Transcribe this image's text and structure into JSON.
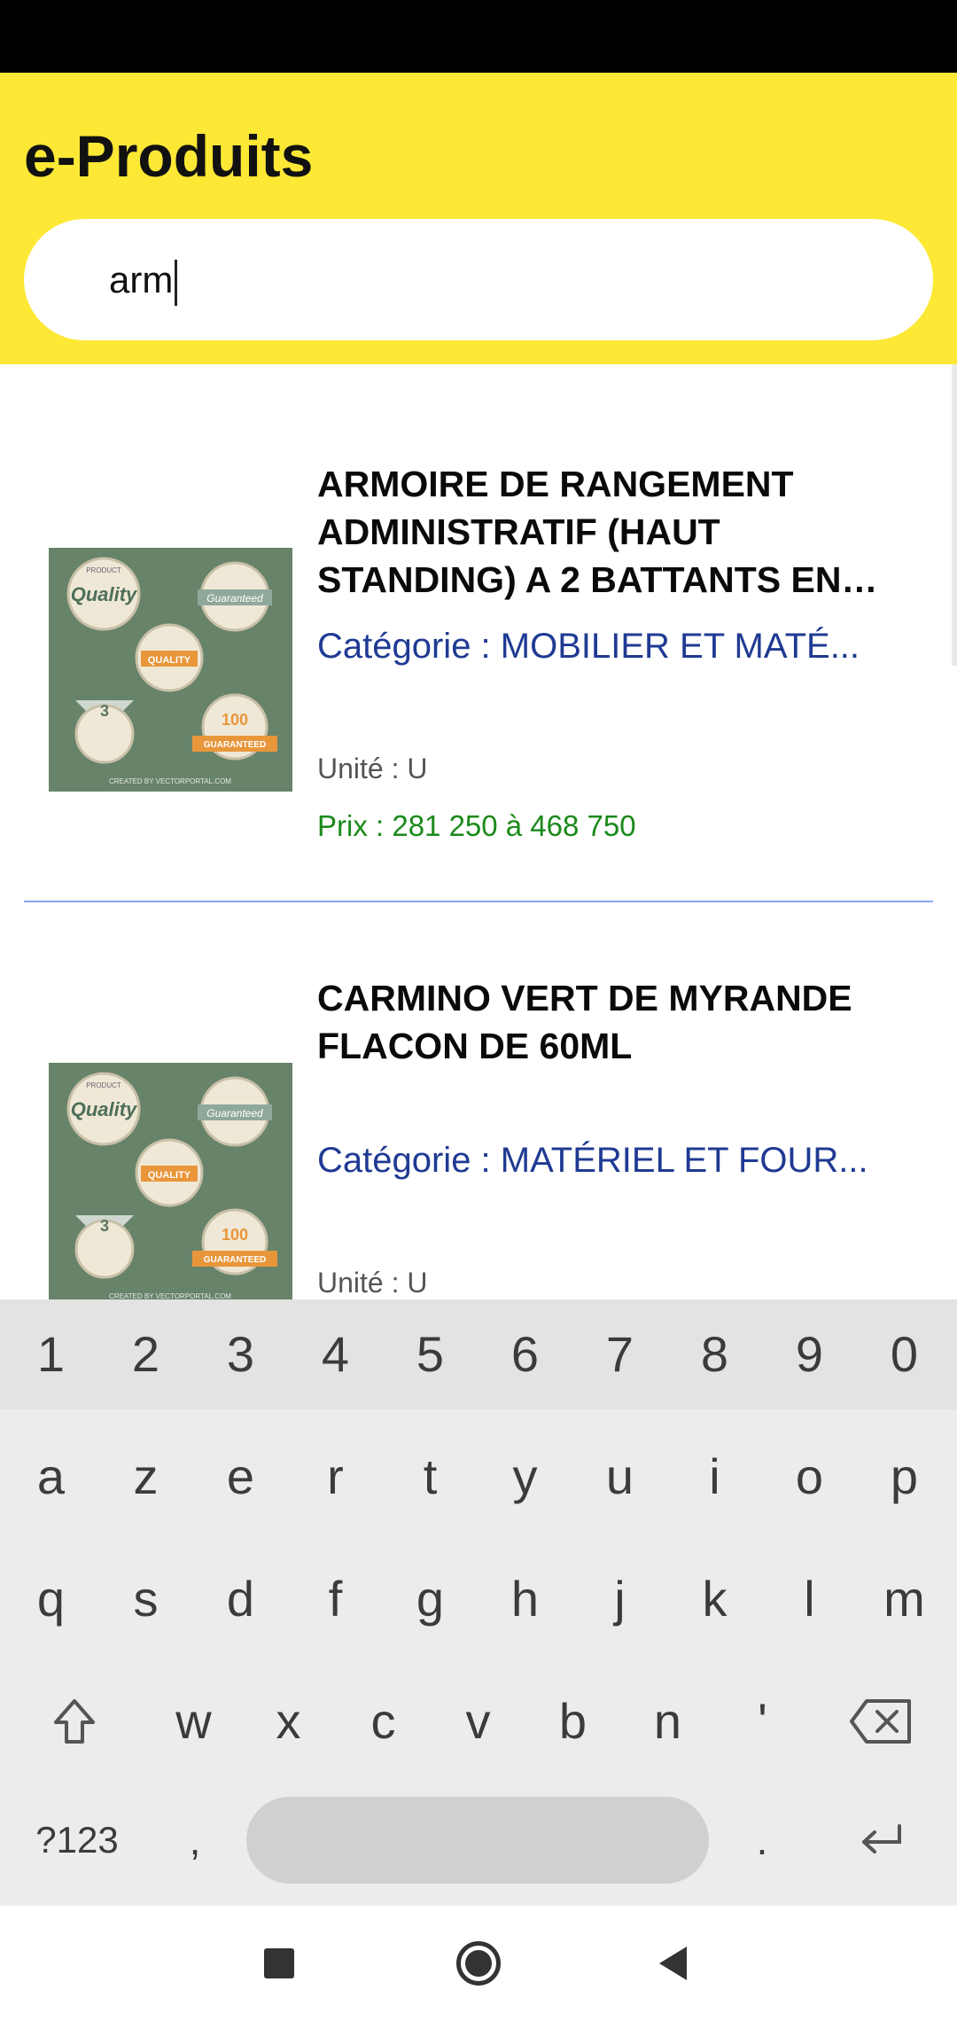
{
  "app": {
    "title": "e-Produits"
  },
  "search": {
    "value": "arm"
  },
  "products": [
    {
      "name": "ARMOIRE DE RANGEMENT ADMINISTRATIF (HAUT STANDING) A 2 BATTANTS EN…",
      "category": "Catégorie : MOBILIER ET MATÉ...",
      "unit": "Unité : U",
      "price": "Prix : 281 250 à 468 750"
    },
    {
      "name": "CARMINO VERT DE MYRANDE FLACON DE 60ML",
      "category": "Catégorie : MATÉRIEL ET FOUR...",
      "unit": "Unité : U"
    }
  ],
  "thumbnail": {
    "badge_product_top": "PRODUCT",
    "badge_quality": "Quality",
    "badge_guaranteed": "Guaranteed",
    "badge_quality_center": "QUALITY",
    "badge_three": "3",
    "badge_hundred": "100",
    "badge_guaranteed_ribbon": "GUARANTEED",
    "credit": "CREATED BY VECTORPORTAL.COM"
  },
  "keyboard": {
    "numbers": [
      "1",
      "2",
      "3",
      "4",
      "5",
      "6",
      "7",
      "8",
      "9",
      "0"
    ],
    "row1": [
      "a",
      "z",
      "e",
      "r",
      "t",
      "y",
      "u",
      "i",
      "o",
      "p"
    ],
    "row2": [
      "q",
      "s",
      "d",
      "f",
      "g",
      "h",
      "j",
      "k",
      "l",
      "m"
    ],
    "row3": [
      "w",
      "x",
      "c",
      "v",
      "b",
      "n",
      "'"
    ],
    "symbols_label": "?123",
    "comma": ",",
    "period": "."
  },
  "colors": {
    "header": "#fde835",
    "category": "#1f3a93",
    "price": "#1a8a1a",
    "thumbnail_bg": "#67836a"
  },
  "icons": {
    "shift": "shift-icon",
    "backspace": "backspace-icon",
    "enter": "enter-icon",
    "recents": "square-recents-icon",
    "home": "circle-home-icon",
    "back": "triangle-back-icon"
  }
}
